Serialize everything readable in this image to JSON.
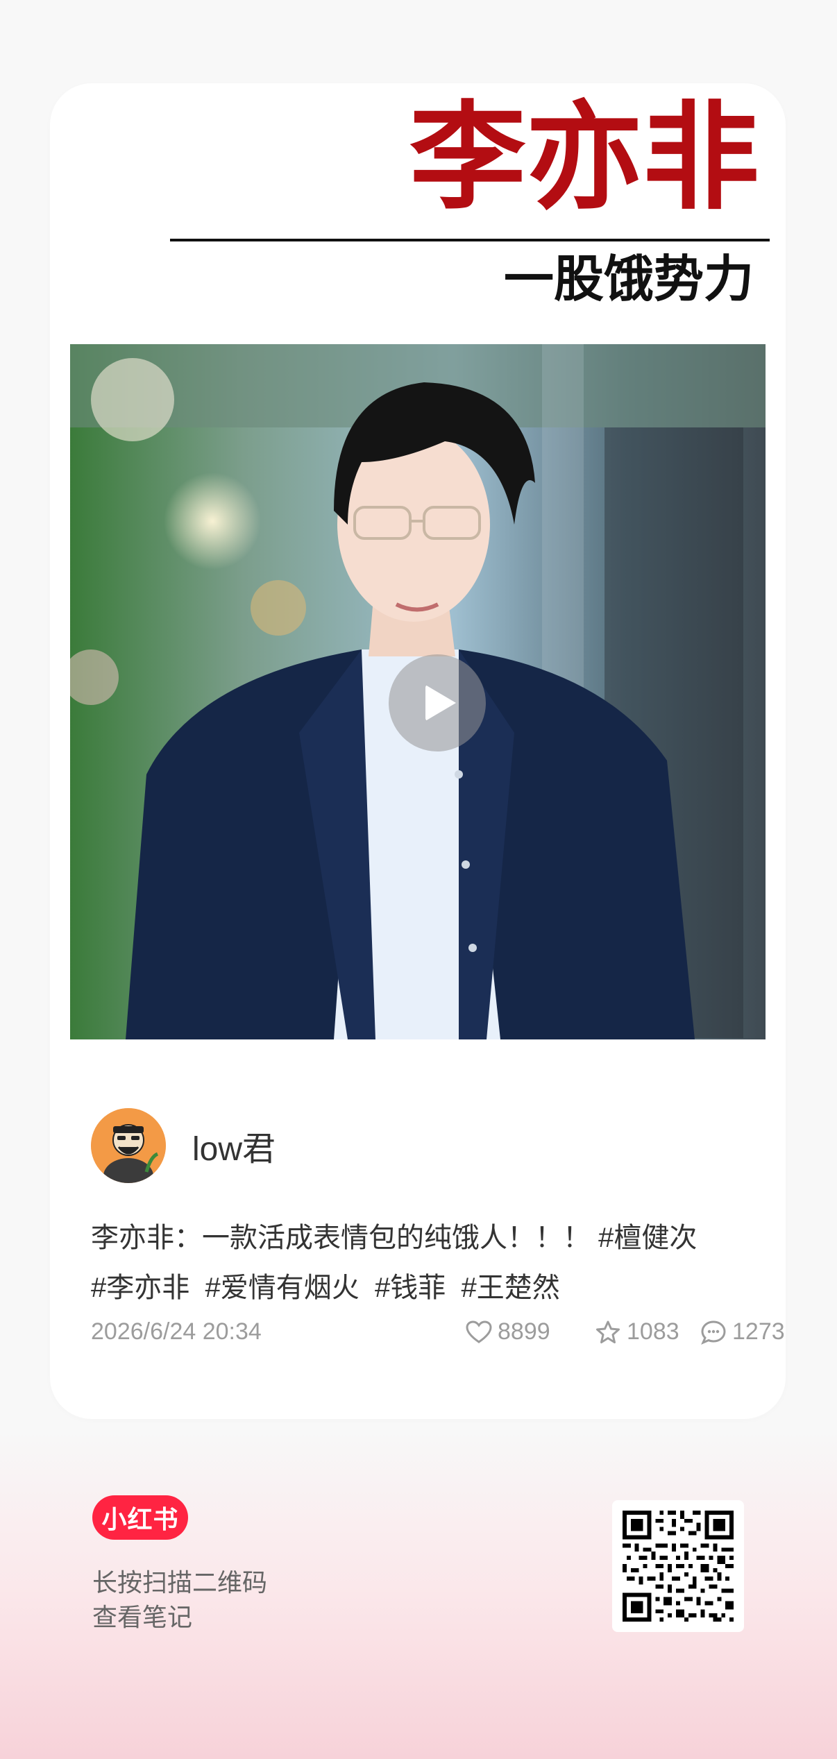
{
  "header": {
    "title": "李亦非",
    "subtitle": "一股饿势力"
  },
  "video": {
    "play_icon": "play-icon"
  },
  "author": {
    "name": "low君",
    "avatar_icon": "avatar"
  },
  "post": {
    "text": "李亦非：一款活成表情包的纯饿人！！！",
    "tags": [
      "#檀健次",
      "#李亦非",
      "#爱情有烟火",
      "#钱菲",
      "#王楚然"
    ]
  },
  "meta": {
    "time": "2026/6/24 20:34",
    "likes": "8899",
    "favorites": "1083",
    "comments": "1273"
  },
  "footer": {
    "logo": "小红书",
    "line1": "长按扫描二维码",
    "line2": "查看笔记",
    "brand_color": "#ff2442"
  }
}
